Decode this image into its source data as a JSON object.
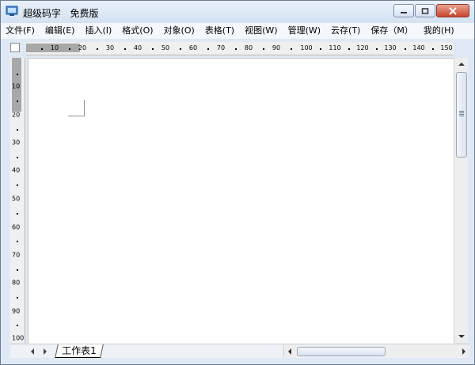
{
  "window": {
    "title": "超级码字   免费版",
    "accent": "#dfe9f5",
    "close_color": "#c9432c"
  },
  "menu": {
    "items": [
      {
        "label": "文件(F)"
      },
      {
        "label": "编辑(E)"
      },
      {
        "label": "插入(I)"
      },
      {
        "label": "格式(O)"
      },
      {
        "label": "对象(O)"
      },
      {
        "label": "表格(T)"
      },
      {
        "label": "视图(W)"
      },
      {
        "label": "管理(W)"
      },
      {
        "label": "云存(T)"
      },
      {
        "label": "保存（M）"
      },
      {
        "label": "我的(H)"
      }
    ]
  },
  "hruler": {
    "labels": [
      "10",
      "20",
      "30",
      "40",
      "50",
      "60",
      "70",
      "80",
      "90",
      "100",
      "110",
      "120",
      "130",
      "140",
      "150"
    ]
  },
  "vruler": {
    "labels": [
      "10",
      "20",
      "30",
      "40",
      "50",
      "60",
      "70",
      "80",
      "90",
      "100"
    ]
  },
  "icons": {
    "app": "app-window-icon",
    "minimize": "minimize-icon",
    "maximize": "maximize-icon",
    "close": "close-icon"
  },
  "sheets": {
    "tabs": [
      {
        "label": "工作表1"
      }
    ]
  }
}
